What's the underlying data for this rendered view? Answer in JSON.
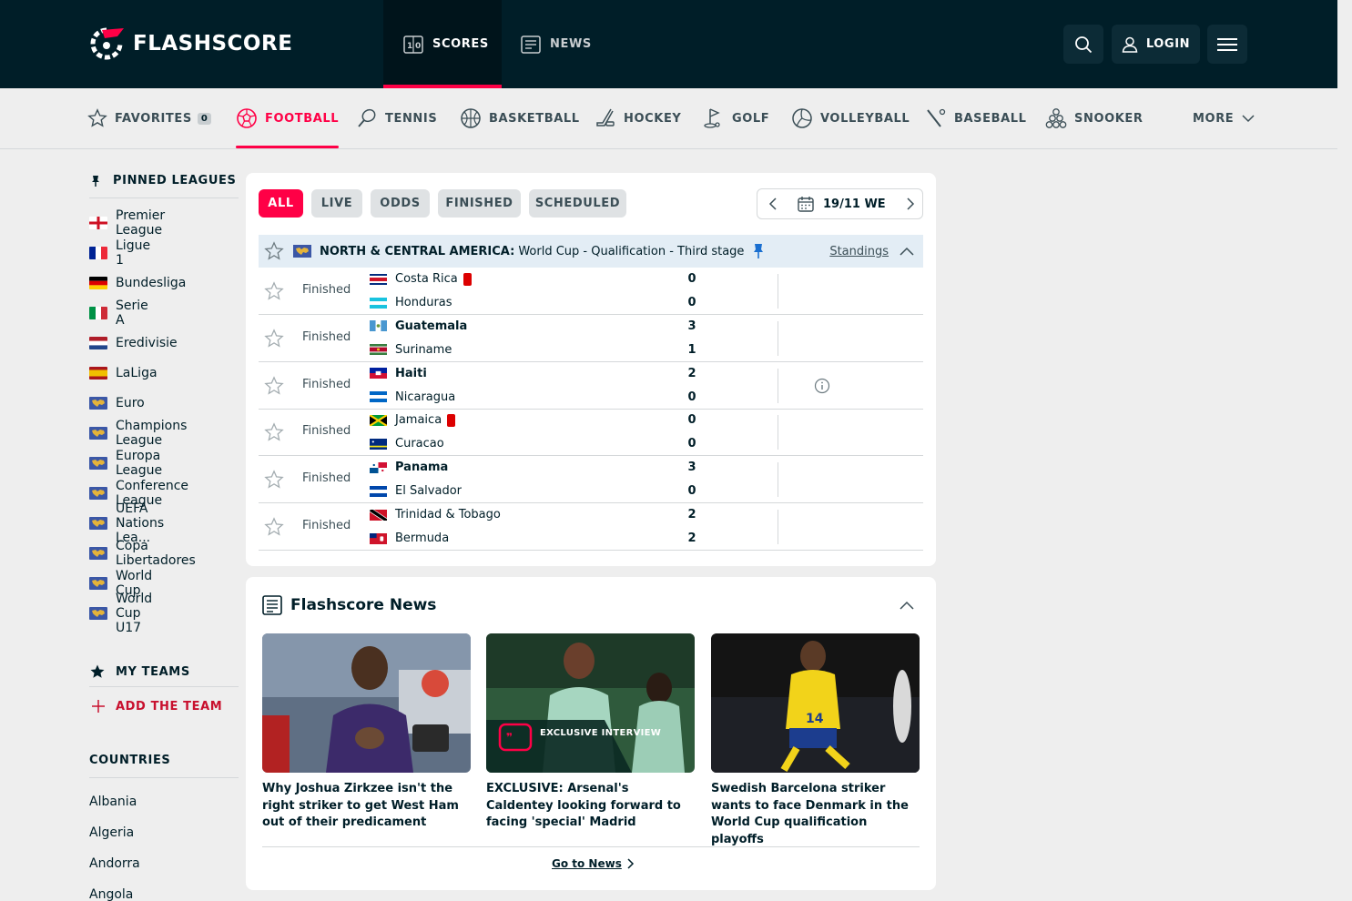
{
  "header": {
    "logo_text": "FLASHSCORE",
    "nav": [
      {
        "label": "SCORES",
        "icon": "scoreboard-icon",
        "active": true
      },
      {
        "label": "NEWS",
        "icon": "newspaper-icon",
        "active": false
      }
    ],
    "login_label": "LOGIN",
    "brand_color": "#ff0046",
    "header_bg": "#001e28"
  },
  "sports": [
    {
      "label": "FAVORITES",
      "icon": "star-icon",
      "badge": "0"
    },
    {
      "label": "FOOTBALL",
      "icon": "football-icon",
      "active": true
    },
    {
      "label": "TENNIS",
      "icon": "tennis-icon"
    },
    {
      "label": "BASKETBALL",
      "icon": "basketball-icon"
    },
    {
      "label": "HOCKEY",
      "icon": "hockey-icon"
    },
    {
      "label": "GOLF",
      "icon": "golf-icon"
    },
    {
      "label": "VOLLEYBALL",
      "icon": "volleyball-icon"
    },
    {
      "label": "BASEBALL",
      "icon": "baseball-icon"
    },
    {
      "label": "SNOOKER",
      "icon": "snooker-icon"
    },
    {
      "label": "MORE",
      "icon": "chevron-down-icon"
    }
  ],
  "sidebar": {
    "pinned_title": "PINNED LEAGUES",
    "leagues": [
      {
        "name": "Premier League",
        "flag": "england"
      },
      {
        "name": "Ligue 1",
        "flag": "france"
      },
      {
        "name": "Bundesliga",
        "flag": "germany"
      },
      {
        "name": "Serie A",
        "flag": "italy"
      },
      {
        "name": "Eredivisie",
        "flag": "netherlands"
      },
      {
        "name": "LaLiga",
        "flag": "spain"
      },
      {
        "name": "Euro",
        "flag": "world"
      },
      {
        "name": "Champions League",
        "flag": "world"
      },
      {
        "name": "Europa League",
        "flag": "world"
      },
      {
        "name": "Conference League",
        "flag": "world"
      },
      {
        "name": "UEFA Nations Lea...",
        "flag": "world"
      },
      {
        "name": "Copa Libertadores",
        "flag": "world"
      },
      {
        "name": "World Cup",
        "flag": "world"
      },
      {
        "name": "World Cup U17",
        "flag": "world"
      }
    ],
    "my_teams_title": "MY TEAMS",
    "add_team_label": "ADD THE TEAM",
    "countries_title": "COUNTRIES",
    "countries": [
      "Albania",
      "Algeria",
      "Andorra",
      "Angola"
    ]
  },
  "matches_panel": {
    "filters": [
      "ALL",
      "LIVE",
      "ODDS",
      "FINISHED",
      "SCHEDULED"
    ],
    "active_filter": "ALL",
    "date_label": "19/11 WE",
    "league": {
      "country": "NORTH & CENTRAL AMERICA:",
      "name": "World Cup - Qualification - Third stage",
      "standings_label": "Standings"
    },
    "matches": [
      {
        "status": "Finished",
        "home": "Costa Rica",
        "away": "Honduras",
        "home_score": "0",
        "away_score": "0",
        "home_win": false,
        "away_win": false,
        "home_red": true,
        "away_red": false,
        "info": false
      },
      {
        "status": "Finished",
        "home": "Guatemala",
        "away": "Suriname",
        "home_score": "3",
        "away_score": "1",
        "home_win": true,
        "away_win": false,
        "home_red": false,
        "away_red": false,
        "info": false
      },
      {
        "status": "Finished",
        "home": "Haiti",
        "away": "Nicaragua",
        "home_score": "2",
        "away_score": "0",
        "home_win": true,
        "away_win": false,
        "home_red": false,
        "away_red": false,
        "info": true
      },
      {
        "status": "Finished",
        "home": "Jamaica",
        "away": "Curacao",
        "home_score": "0",
        "away_score": "0",
        "home_win": false,
        "away_win": false,
        "home_red": true,
        "away_red": false,
        "info": false
      },
      {
        "status": "Finished",
        "home": "Panama",
        "away": "El Salvador",
        "home_score": "3",
        "away_score": "0",
        "home_win": true,
        "away_win": false,
        "home_red": false,
        "away_red": false,
        "info": false
      },
      {
        "status": "Finished",
        "home": "Trinidad & Tobago",
        "away": "Bermuda",
        "home_score": "2",
        "away_score": "2",
        "home_win": false,
        "away_win": false,
        "home_red": false,
        "away_red": false,
        "info": false
      }
    ]
  },
  "news_panel": {
    "title": "Flashscore News",
    "articles": [
      {
        "headline": "Why Joshua Zirkzee isn't the right striker to get West Ham out of their predicament"
      },
      {
        "headline": "EXCLUSIVE: Arsenal's Caldentey looking forward to facing 'special' Madrid",
        "overlay": "EXCLUSIVE INTERVIEW"
      },
      {
        "headline": "Swedish Barcelona striker wants to face Denmark in the World Cup qualification playoffs"
      }
    ],
    "go_to_news_label": "Go to News"
  }
}
